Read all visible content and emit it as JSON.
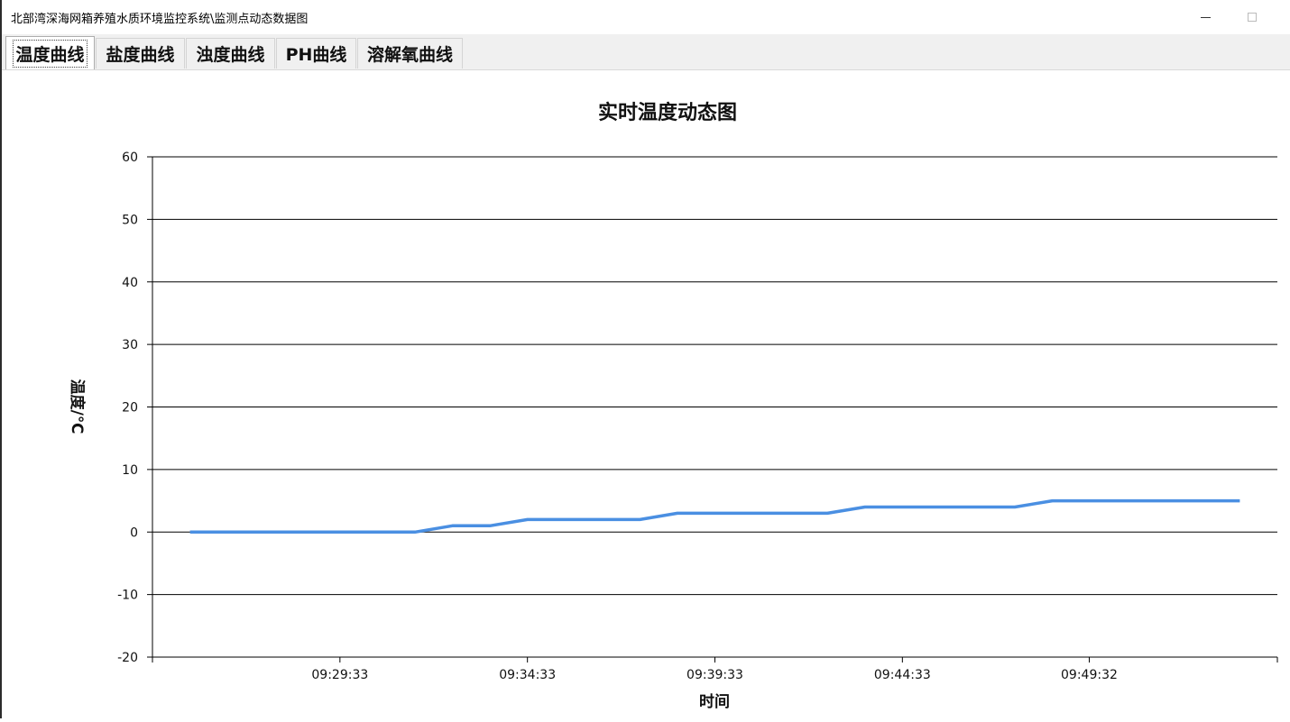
{
  "window": {
    "title": "北部湾深海网箱养殖水质环境监控系统\\监测点动态数据图"
  },
  "tabs": [
    {
      "label": "温度曲线",
      "active": true
    },
    {
      "label": "盐度曲线",
      "active": false
    },
    {
      "label": "浊度曲线",
      "active": false
    },
    {
      "label": "PH曲线",
      "active": false
    },
    {
      "label": "溶解氧曲线",
      "active": false
    }
  ],
  "colors": {
    "series": "#4a8fe2",
    "grid": "#000000"
  },
  "chart_data": {
    "type": "line",
    "title": "实时温度动态图",
    "xlabel": "时间",
    "ylabel": "温度/℃",
    "ylim": [
      -20,
      60
    ],
    "yticks": [
      -20,
      -10,
      0,
      10,
      20,
      30,
      40,
      50,
      60
    ],
    "xlim": [
      "09:24:33",
      "09:54:33"
    ],
    "xticks": [
      "09:29:33",
      "09:34:33",
      "09:39:33",
      "09:44:33",
      "09:49:32"
    ],
    "grid": "horizontal",
    "series": [
      {
        "x": [
          "09:25:33",
          "09:31:33",
          "09:32:33",
          "09:33:33",
          "09:34:33",
          "09:37:33",
          "09:38:33",
          "09:42:33",
          "09:43:33",
          "09:47:33",
          "09:48:33",
          "09:53:33"
        ],
        "values": [
          0,
          0,
          1,
          1,
          2,
          2,
          3,
          3,
          4,
          4,
          5,
          5
        ]
      }
    ]
  }
}
